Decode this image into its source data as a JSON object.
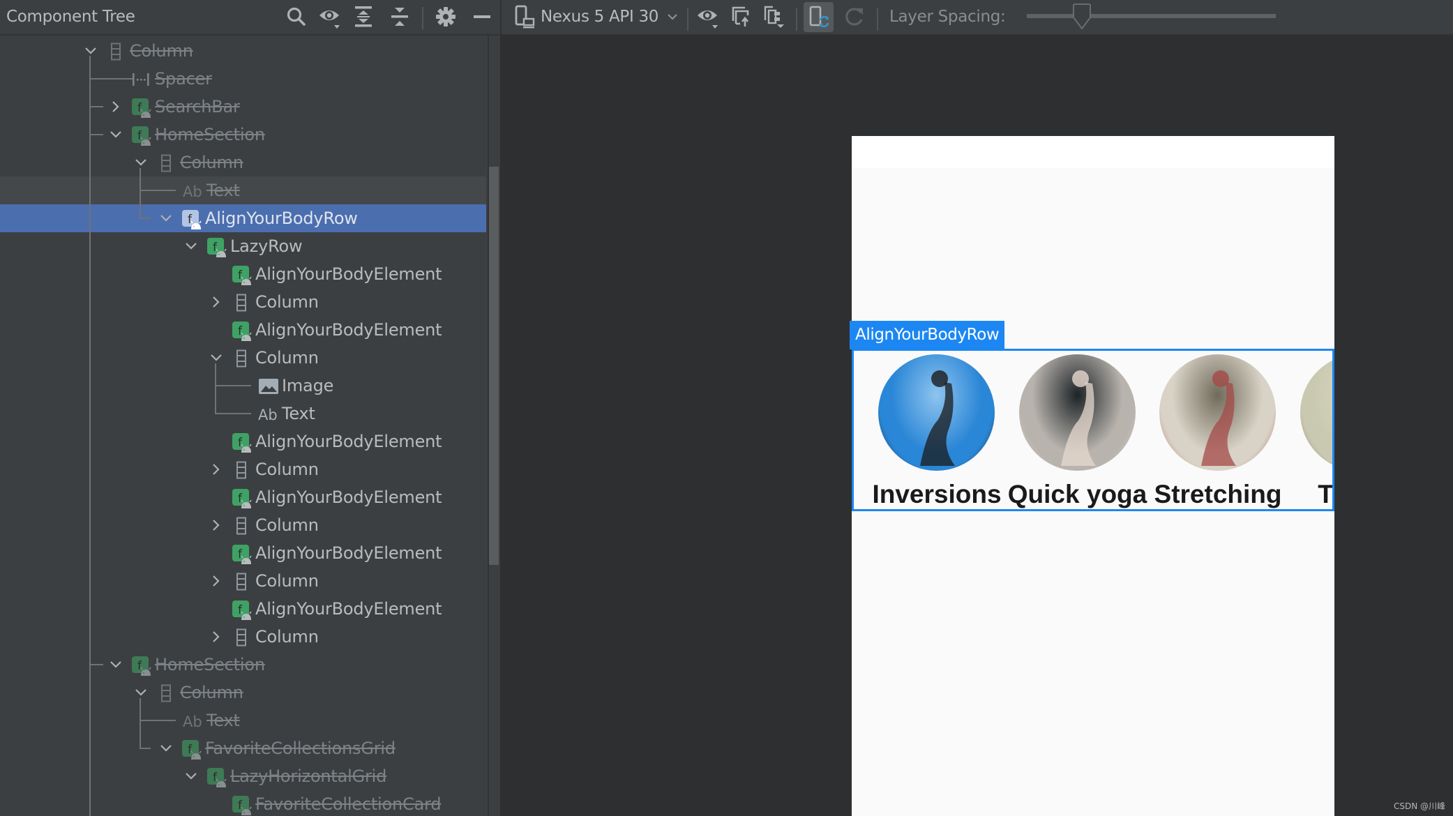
{
  "left_panel": {
    "title": "Component Tree",
    "toolbar": [
      {
        "name": "search-icon",
        "label": "Search"
      },
      {
        "name": "eye-filter-icon",
        "label": "View options"
      },
      {
        "name": "expand-all-icon",
        "label": "Expand all"
      },
      {
        "name": "collapse-all-icon",
        "label": "Collapse all"
      },
      {
        "name": "gear-icon",
        "label": "Settings"
      },
      {
        "name": "minimize-icon",
        "label": "Hide"
      }
    ],
    "tree": [
      {
        "label": "Column",
        "level": 0,
        "icon": "column",
        "chevron": "down",
        "muted": true
      },
      {
        "label": "Spacer",
        "level": 1,
        "icon": "spacer",
        "chevron": null,
        "muted": true
      },
      {
        "label": "SearchBar",
        "level": 1,
        "icon": "compose",
        "chevron": "right",
        "muted": true
      },
      {
        "label": "HomeSection",
        "level": 1,
        "icon": "compose",
        "chevron": "down",
        "muted": true
      },
      {
        "label": "Column",
        "level": 2,
        "icon": "column",
        "chevron": "down",
        "muted": true
      },
      {
        "label": "Text",
        "level": 3,
        "icon": "text",
        "chevron": null,
        "muted": true,
        "hover": true
      },
      {
        "label": "AlignYourBodyRow",
        "level": 3,
        "icon": "compose",
        "chevron": "down",
        "muted": false,
        "selected": true
      },
      {
        "label": "LazyRow",
        "level": 4,
        "icon": "compose",
        "chevron": "down",
        "muted": false
      },
      {
        "label": "AlignYourBodyElement",
        "level": 5,
        "icon": "compose",
        "chevron": null,
        "muted": false
      },
      {
        "label": "Column",
        "level": 5,
        "icon": "column",
        "chevron": "right",
        "muted": false
      },
      {
        "label": "AlignYourBodyElement",
        "level": 5,
        "icon": "compose",
        "chevron": null,
        "muted": false
      },
      {
        "label": "Column",
        "level": 5,
        "icon": "column",
        "chevron": "down",
        "muted": false
      },
      {
        "label": "Image",
        "level": 6,
        "icon": "image",
        "chevron": null,
        "muted": false
      },
      {
        "label": "Text",
        "level": 6,
        "icon": "text",
        "chevron": null,
        "muted": false
      },
      {
        "label": "AlignYourBodyElement",
        "level": 5,
        "icon": "compose",
        "chevron": null,
        "muted": false
      },
      {
        "label": "Column",
        "level": 5,
        "icon": "column",
        "chevron": "right",
        "muted": false
      },
      {
        "label": "AlignYourBodyElement",
        "level": 5,
        "icon": "compose",
        "chevron": null,
        "muted": false
      },
      {
        "label": "Column",
        "level": 5,
        "icon": "column",
        "chevron": "right",
        "muted": false
      },
      {
        "label": "AlignYourBodyElement",
        "level": 5,
        "icon": "compose",
        "chevron": null,
        "muted": false
      },
      {
        "label": "Column",
        "level": 5,
        "icon": "column",
        "chevron": "right",
        "muted": false
      },
      {
        "label": "AlignYourBodyElement",
        "level": 5,
        "icon": "compose",
        "chevron": null,
        "muted": false
      },
      {
        "label": "Column",
        "level": 5,
        "icon": "column",
        "chevron": "right",
        "muted": false
      },
      {
        "label": "HomeSection",
        "level": 1,
        "icon": "compose",
        "chevron": "down",
        "muted": true
      },
      {
        "label": "Column",
        "level": 2,
        "icon": "column",
        "chevron": "down",
        "muted": true
      },
      {
        "label": "Text",
        "level": 3,
        "icon": "text",
        "chevron": null,
        "muted": true
      },
      {
        "label": "FavoriteCollectionsGrid",
        "level": 3,
        "icon": "compose",
        "chevron": "down",
        "muted": true
      },
      {
        "label": "LazyHorizontalGrid",
        "level": 4,
        "icon": "compose",
        "chevron": "down",
        "muted": true
      },
      {
        "label": "FavoriteCollectionCard",
        "level": 5,
        "icon": "compose",
        "chevron": null,
        "muted": true
      }
    ]
  },
  "right_panel": {
    "device_selector": "Nexus 5 API 30",
    "toolbar": [
      {
        "name": "display-options-icon",
        "label": "View options"
      },
      {
        "name": "export-snapshot-icon",
        "label": "Export snapshot"
      },
      {
        "name": "layer-tree-icon",
        "label": "Layer tree"
      },
      {
        "name": "live-updates-icon",
        "label": "Live updates",
        "active": true
      },
      {
        "name": "refresh-icon",
        "label": "Refresh",
        "disabled": true
      }
    ],
    "layer_spacing_label": "Layer Spacing:",
    "layer_spacing_value": 0.22
  },
  "preview": {
    "selected_component": "AlignYourBodyRow",
    "elements": [
      {
        "label": "Inversions",
        "image": "person doing a yoga inversion by the sea",
        "colors": [
          "#2a86d6",
          "#8ec4ef",
          "#1b1b1b"
        ]
      },
      {
        "label": "Quick yoga",
        "image": "woman in black top stretching",
        "colors": [
          "#b8b3ad",
          "#1d2326",
          "#e7d9cf"
        ]
      },
      {
        "label": "Stretching",
        "image": "two women stretching on floor",
        "colors": [
          "#d9d2c6",
          "#6f6b5a",
          "#a44a48"
        ]
      },
      {
        "label": "Tabata",
        "image": "person exercising in green room",
        "colors": [
          "#c9c9b2",
          "#ddd7c0",
          "#9a6b4e"
        ]
      }
    ]
  },
  "watermark": "CSDN @川峰",
  "colors": {
    "selection": "#4b6eaf",
    "compose_icon": "#3e8f5e",
    "highlight_border": "#1c87f2",
    "panel_bg": "#3c3f41",
    "canvas_bg": "#2d2f31"
  }
}
